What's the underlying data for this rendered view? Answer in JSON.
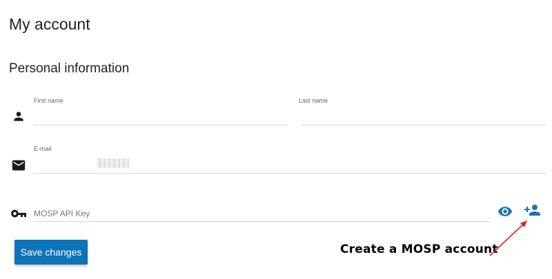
{
  "page": {
    "title": "My account"
  },
  "section": {
    "title": "Personal information"
  },
  "fields": {
    "first_name": {
      "label": "First name",
      "value": ""
    },
    "last_name": {
      "label": "Last name",
      "value": ""
    },
    "email": {
      "label": "E-mail",
      "value": ""
    },
    "mosp_api_key": {
      "placeholder": "MOSP API Key",
      "value": ""
    }
  },
  "buttons": {
    "save_label": "Save changes"
  },
  "annotation": {
    "text": "Create a MOSP account"
  },
  "icons": {
    "person": "person-icon",
    "email": "email-icon",
    "key": "key-icon",
    "visibility": "visibility-icon",
    "add_person": "person-add-icon"
  },
  "colors": {
    "primary": "#0f73ba",
    "annotation_arrow": "#e0201c"
  }
}
